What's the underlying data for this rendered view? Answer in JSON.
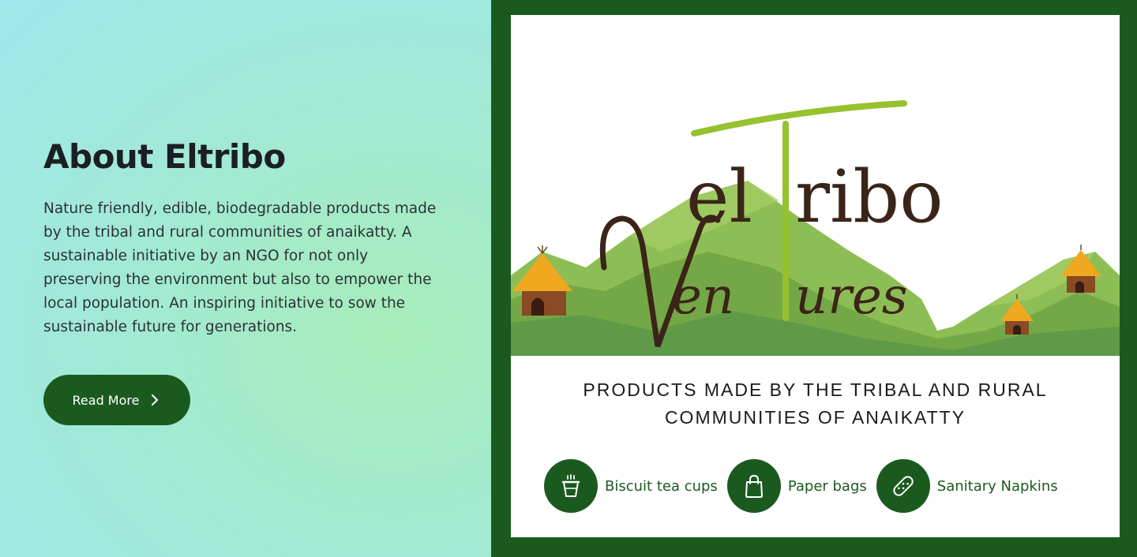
{
  "about": {
    "title": "About Eltribo",
    "description": "Nature friendly, edible, biodegradable products made by the tribal and rural communities of anaikatty. A sustainable initiative by an NGO for not only preserving the environment but also to empower the local population. An inspiring initiative to sow the sustainable future for generations.",
    "read_more_label": "Read More"
  },
  "logo": {
    "line1": "elTribo",
    "line2": "Ventures"
  },
  "tagline": {
    "line1": "PRODUCTS MADE BY THE TRIBAL AND RURAL",
    "line2": "COMMUNITIES OF ANAIKATTY"
  },
  "products": [
    {
      "label": "Biscuit tea cups",
      "icon": "cup-icon"
    },
    {
      "label": "Paper bags",
      "icon": "bag-icon"
    },
    {
      "label": "Sanitary Napkins",
      "icon": "napkin-icon"
    }
  ],
  "colors": {
    "brand_green": "#1b5a1f",
    "logo_brown": "#3b2418",
    "logo_lime": "#8fbf2c",
    "hill_green": "#7fb04a",
    "hut_orange": "#e8a020"
  }
}
